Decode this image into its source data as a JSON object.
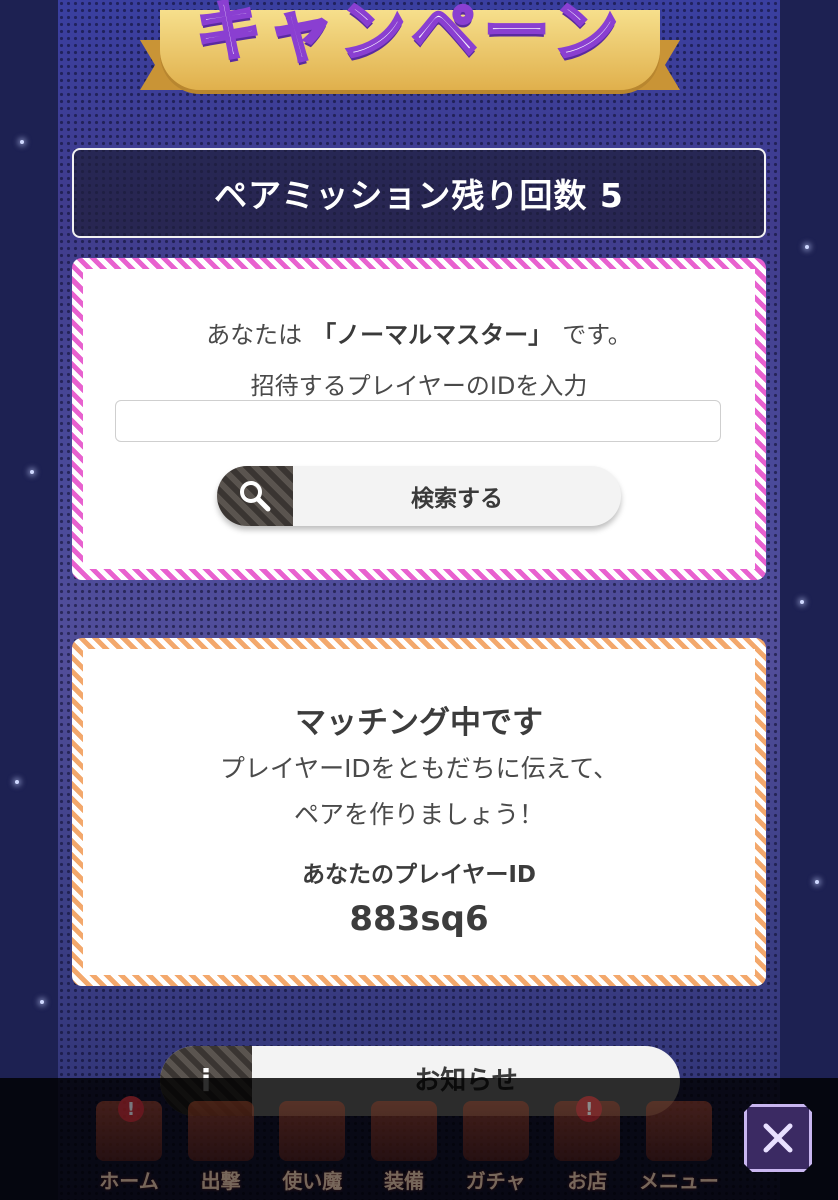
{
  "banner": {
    "title": "キャンペーン"
  },
  "mission": {
    "remaining_text": "ペアミッション残り回数 5"
  },
  "invite": {
    "you_are_prefix": "あなたは",
    "rank": "「ノーマルマスター」",
    "you_are_suffix": "です。",
    "input_label": "招待するプレイヤーのIDを入力",
    "input_value": "",
    "search_button_label": "検索する"
  },
  "matching": {
    "title": "マッチング中です",
    "desc_line1": "プレイヤーIDをともだちに伝えて、",
    "desc_line2": "ペアを作りましょう！",
    "player_id_label": "あなたのプレイヤーID",
    "player_id_value": "883sq6"
  },
  "news": {
    "label": "お知らせ",
    "icon": "info-icon"
  },
  "nav": {
    "items": [
      {
        "label": "ホーム",
        "badge": "!"
      },
      {
        "label": "出撃",
        "badge": ""
      },
      {
        "label": "使い魔",
        "badge": ""
      },
      {
        "label": "装備",
        "badge": ""
      },
      {
        "label": "ガチャ",
        "badge": ""
      },
      {
        "label": "お店",
        "badge": "!"
      },
      {
        "label": "メニュー",
        "badge": ""
      }
    ]
  },
  "colors": {
    "pink_border": "#e861cf",
    "orange_border": "#f3a86c",
    "background": "#1d2152"
  }
}
